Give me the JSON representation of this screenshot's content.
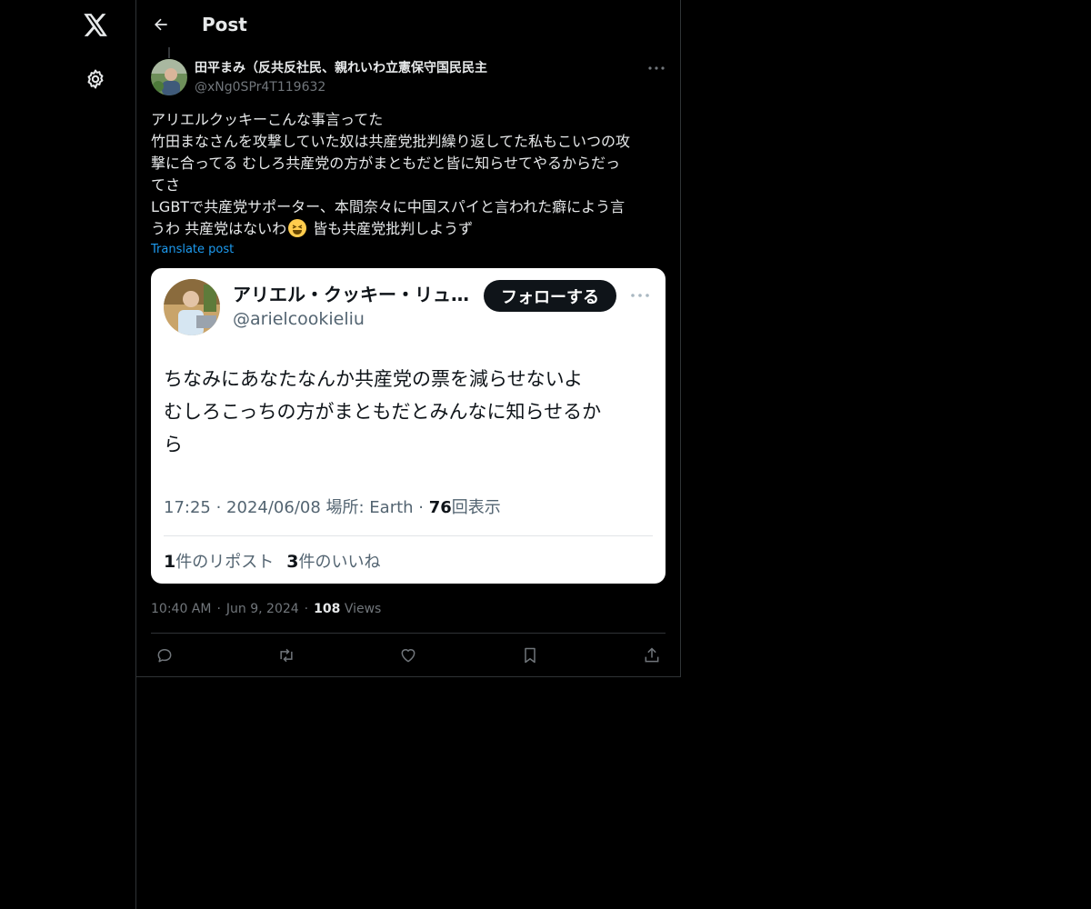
{
  "header": {
    "title": "Post"
  },
  "post": {
    "author_name": "田平まみ（反共反社民、親れいわ立憲保守国民民主",
    "author_handle": "@xNg0SPr4T119632",
    "text_lines": [
      "アリエルクッキーこんな事言ってた",
      "竹田まなさんを攻撃していた奴は共産党批判繰り返してた私もこいつの攻",
      "撃に合ってる むしろ共産党の方がまともだと皆に知らせてやるからだっ",
      "てさ",
      "LGBTで共産党サポーター、本間奈々に中国スパイと言われた癖によう言",
      "うわ 共産党はないわ",
      " 皆も共産党批判しようず"
    ],
    "translate_label": "Translate post",
    "time": "10:40 AM",
    "date": "Jun 9, 2024",
    "views_count": "108",
    "views_label": "Views"
  },
  "embed": {
    "name": "アリエル・クッキー・リュ…",
    "handle": "@arielcookieliu",
    "follow_label": "フォローする",
    "text_lines": [
      "ちなみにあなたなんか共産党の票を減らせないよ",
      "むしろこっちの方がまともだとみんなに知らせるか",
      "ら"
    ],
    "meta_prefix": "17:25 · 2024/06/08 場所: Earth · ",
    "views_count": "76",
    "views_label": "回表示",
    "reposts_count": "1",
    "reposts_label": "件のリポスト",
    "likes_count": "3",
    "likes_label": "件のいいね"
  },
  "icons": {
    "logo": "x-logo-icon",
    "settings": "gear-icon",
    "back": "arrow-left-icon",
    "more": "ellipsis-icon",
    "reply": "reply-icon",
    "repost": "repost-icon",
    "like": "heart-icon",
    "bookmark": "bookmark-icon",
    "share": "share-icon"
  },
  "colors": {
    "background": "#000000",
    "text_primary": "#e7e9ea",
    "text_secondary": "#71767b",
    "accent": "#1d9bf0",
    "border": "#2f3336"
  }
}
